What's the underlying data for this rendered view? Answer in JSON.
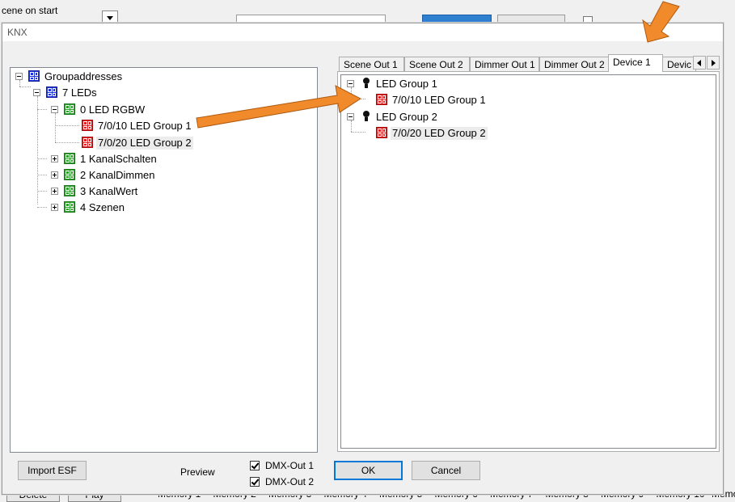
{
  "background_app": {
    "scene_label": "cene on start",
    "bottom_buttons": [
      "Delete",
      "Play"
    ],
    "memory_tabs": [
      "Memory 1",
      "Memory 2",
      "Memory 3",
      "Memory 4",
      "Memory 5",
      "Memory 6",
      "Memory 7",
      "Memory 8",
      "Memory 9",
      "Memory 10",
      "Memo"
    ]
  },
  "dialog": {
    "title": "KNX"
  },
  "left_tree": {
    "root": "Groupaddresses",
    "l1": "7 LEDs",
    "l2_open": "0 LED RGBW",
    "addr1": "7/0/10 LED Group 1",
    "addr2": "7/0/20 LED Group 2",
    "collapsed": [
      "1 KanalSchalten",
      "2 KanalDimmen",
      "3 KanalWert",
      "4 Szenen"
    ]
  },
  "tabs": [
    "Scene Out 1",
    "Scene Out 2",
    "Dimmer Out 1",
    "Dimmer Out 2",
    "Device 1",
    "Devic"
  ],
  "active_tab_index": 4,
  "right_tree": {
    "group1": "LED Group 1",
    "group1_addr": "7/0/10 LED Group 1",
    "group2": "LED Group 2",
    "group2_addr": "7/0/20 LED Group 2"
  },
  "footer": {
    "import_button": "Import ESF",
    "preview_label": "Preview",
    "dmx_out1": "DMX-Out 1",
    "dmx_out2": "DMX-Out 2",
    "dmx_out1_checked": true,
    "dmx_out2_checked": true,
    "ok_button": "OK",
    "cancel_button": "Cancel"
  },
  "colors": {
    "annotation_arrow": "#f08a2a",
    "group_icon_blue": "#2033d6",
    "group_icon_green": "#2ea02e",
    "group_icon_red": "#e02020",
    "selection_blue": "#2f7fd0"
  }
}
